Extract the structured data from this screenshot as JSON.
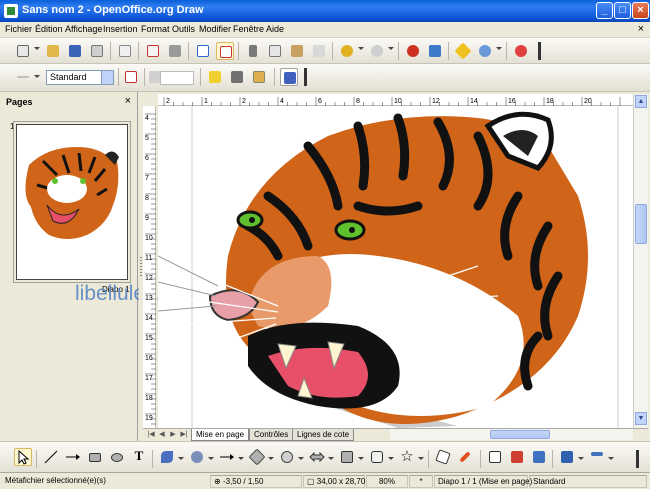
{
  "window": {
    "title": "Sans nom 2 - OpenOffice.org Draw",
    "controls": [
      "minimize-icon",
      "maximize-icon",
      "close-icon"
    ]
  },
  "menubar": {
    "items": [
      {
        "label": "Fichier"
      },
      {
        "label": "Édition"
      },
      {
        "label": "Affichage"
      },
      {
        "label": "Insertion"
      },
      {
        "label": "Format"
      },
      {
        "label": "Outils"
      },
      {
        "label": "Modifier"
      },
      {
        "label": "Fenêtre"
      },
      {
        "label": "Aide"
      }
    ],
    "close": "×"
  },
  "toolbar2": {
    "style_value": "Standard"
  },
  "pages_panel": {
    "title": "Pages",
    "close": "×",
    "page_number": "1",
    "page_label": "Diapo 1"
  },
  "ruler": {
    "h_labels": [
      "2",
      "1",
      "2",
      "4",
      "6",
      "8",
      "10",
      "12",
      "14",
      "16",
      "18",
      "20"
    ],
    "v_labels": [
      "4",
      "5",
      "6",
      "7",
      "8",
      "9",
      "10",
      "11",
      "12",
      "13",
      "14",
      "15",
      "16",
      "17",
      "18",
      "19"
    ]
  },
  "tabs": [
    {
      "label": "Mise en page",
      "active": true
    },
    {
      "label": "Contrôles",
      "active": false
    },
    {
      "label": "Lignes de cote",
      "active": false
    }
  ],
  "watermark": "libellules.ch",
  "statusbar": {
    "selection": "Métafichier sélectionné(e)(s)",
    "position": "-3,50 / 1,50",
    "size": "34,00 x 28,70",
    "zoom": "80%",
    "modified": "*",
    "page": "Diapo 1 / 1 (Mise en page)",
    "layout": "Standard"
  },
  "colors": {
    "titlebar": "#0a5fd8",
    "tiger_orange": "#d0651a",
    "tiger_dark": "#111111",
    "eye_green": "#5fbf2c",
    "mouth_pink": "#e8506a"
  }
}
